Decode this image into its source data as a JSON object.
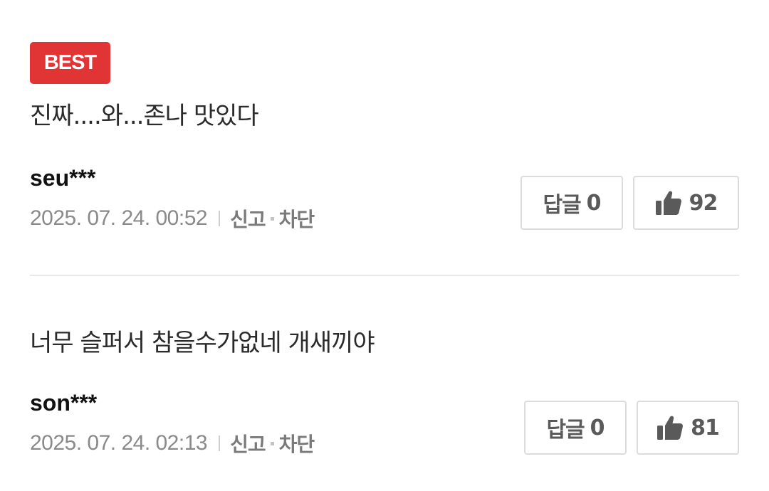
{
  "comments": [
    {
      "badge": "BEST",
      "text": "진짜....와...존나 맛있다",
      "author": "seu***",
      "timestamp": "2025. 07. 24. 00:52",
      "report_label": "신고",
      "block_label": "차단",
      "reply_label": "답글",
      "reply_count": "0",
      "like_count": "92",
      "like_icon": "thumbs-up-icon"
    },
    {
      "text": "너무 슬퍼서 참을수가없네 개새끼야",
      "author": "son***",
      "timestamp": "2025. 07. 24. 02:13",
      "report_label": "신고",
      "block_label": "차단",
      "reply_label": "답글",
      "reply_count": "0",
      "like_count": "81",
      "like_icon": "thumbs-up-icon"
    }
  ],
  "colors": {
    "best_badge": "#e13435",
    "text": "#2b2b2b",
    "meta": "#8a8a8a",
    "border": "#dcdcdc"
  }
}
